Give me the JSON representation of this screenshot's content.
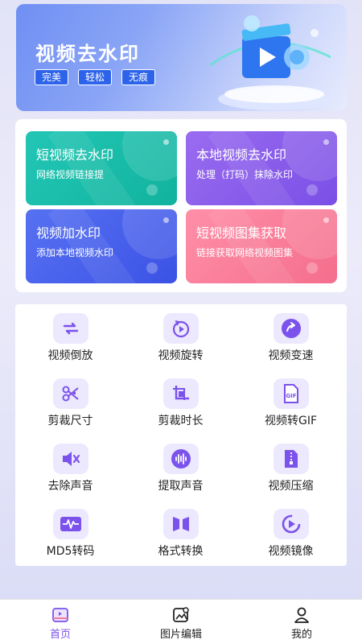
{
  "banner": {
    "title": "视频去水印",
    "tags": [
      "完美",
      "轻松",
      "无痕"
    ]
  },
  "feature_cards": [
    {
      "title": "短视频去水印",
      "desc": "网络视频链接提",
      "color": "#1dbfaa"
    },
    {
      "title": "本地视频去水印",
      "desc": "处理（打码）抹除水印",
      "color": "#8a5cec"
    },
    {
      "title": "视频加水印",
      "desc": "添加本地视频水印",
      "color": "#4a62ec"
    },
    {
      "title": "短视频图集获取",
      "desc": "链接获取网络视频图集",
      "color": "#f87c97"
    }
  ],
  "tools": [
    {
      "label": "视频倒放",
      "icon": "reverse-arrows-icon"
    },
    {
      "label": "视频旋转",
      "icon": "rotate-play-icon"
    },
    {
      "label": "视频变速",
      "icon": "speed-arrow-icon"
    },
    {
      "label": "剪裁尺寸",
      "icon": "scissors-icon"
    },
    {
      "label": "剪裁时长",
      "icon": "crop-frame-icon"
    },
    {
      "label": "视频转GIF",
      "icon": "gif-file-icon"
    },
    {
      "label": "去除声音",
      "icon": "mute-speaker-icon"
    },
    {
      "label": "提取声音",
      "icon": "waveform-circle-icon"
    },
    {
      "label": "视频压缩",
      "icon": "zip-file-icon"
    },
    {
      "label": "MD5转码",
      "icon": "heartbeat-monitor-icon"
    },
    {
      "label": "格式转换",
      "icon": "convert-panels-icon"
    },
    {
      "label": "视频镜像",
      "icon": "mirror-play-icon"
    }
  ],
  "nav": [
    {
      "label": "首页",
      "icon": "home-video-icon",
      "active": true
    },
    {
      "label": "图片编辑",
      "icon": "image-edit-icon",
      "active": false
    },
    {
      "label": "我的",
      "icon": "profile-icon",
      "active": false
    }
  ],
  "colors": {
    "accent": "#7b52ec",
    "icon_bg": "#ece8fd",
    "banner_tag": "#2c63ea"
  }
}
